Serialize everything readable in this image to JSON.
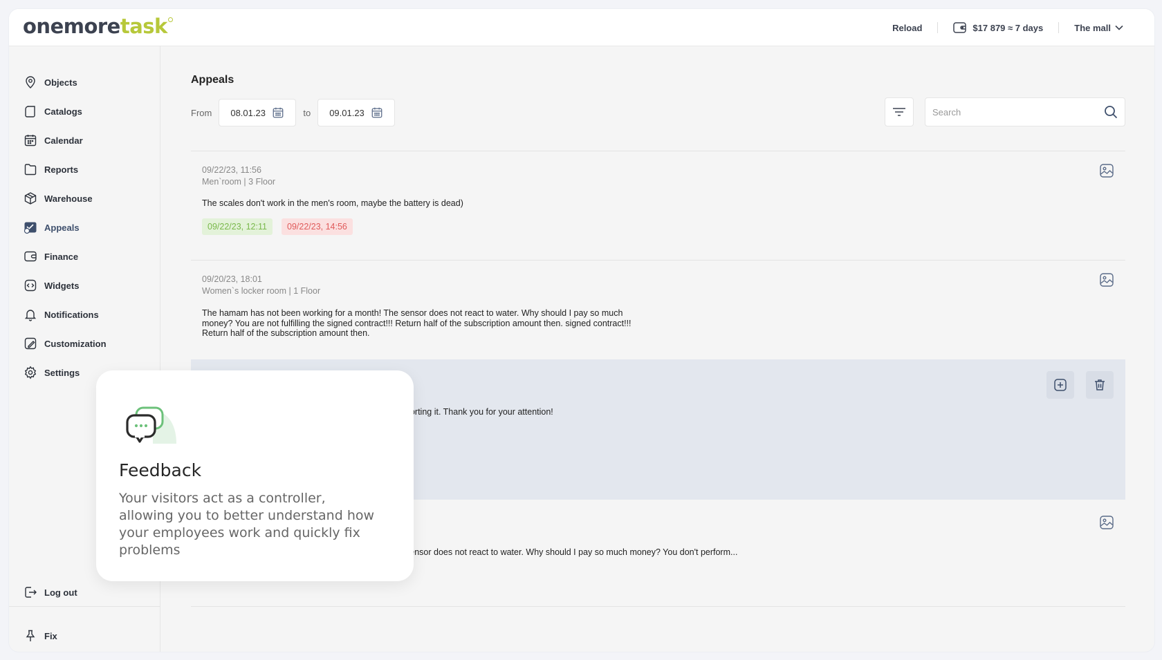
{
  "app": {
    "logo_part1": "onemore",
    "logo_part2": "task"
  },
  "header": {
    "reload_label": "Reload",
    "balance": "$17 879 ≈ 7 days",
    "location": "The mall"
  },
  "sidebar": {
    "items": [
      {
        "label": "Objects",
        "icon": "location-pin-icon"
      },
      {
        "label": "Catalogs",
        "icon": "catalog-icon"
      },
      {
        "label": "Calendar",
        "icon": "calendar-icon"
      },
      {
        "label": "Reports",
        "icon": "folder-icon"
      },
      {
        "label": "Warehouse",
        "icon": "box-icon"
      },
      {
        "label": "Appeals",
        "icon": "appeals-icon",
        "active": true
      },
      {
        "label": "Finance",
        "icon": "wallet-icon"
      },
      {
        "label": "Widgets",
        "icon": "widgets-icon"
      },
      {
        "label": "Notifications",
        "icon": "bell-icon"
      },
      {
        "label": "Customization",
        "icon": "brush-icon"
      },
      {
        "label": "Settings",
        "icon": "gear-icon"
      }
    ],
    "logout_label": "Log out",
    "fix_label": "Fix"
  },
  "main": {
    "title": "Appeals",
    "filter": {
      "from_label": "From",
      "from_date": "08.01.23",
      "to_label": "to",
      "to_date": "09.01.23"
    },
    "search_placeholder": "Search"
  },
  "appeals": [
    {
      "date": "09/22/23, 11:56",
      "location": "Men`room | 3 Floor",
      "text": "The scales don't work in the men's room, maybe the battery is dead)",
      "badges": [
        {
          "text": "09/22/23, 12:11",
          "status": "green"
        },
        {
          "text": "09/22/23, 14:56",
          "status": "red"
        }
      ]
    },
    {
      "date": "09/20/23, 18:01",
      "location": "Women`s locker room | 1 Floor",
      "text_lines": [
        "The hamam has not been working for a month! The sensor does not react to water. Why should I pay so much",
        "money? You are not fulfilling the signed contract!!! Return half of the subscription amount then. signed contract!!!",
        "Return half of the subscription amount then."
      ]
    },
    {
      "text_partial": "porting it. Thank you for your attention!"
    },
    {
      "text_partial": "sensor does not react to water. Why should I pay so much money? You don't perform..."
    }
  ],
  "feedback_card": {
    "title": "Feedback",
    "text": "Your visitors act as a controller, allowing you to better understand how your employees work and quickly fix problems"
  },
  "colors": {
    "accent": "#b7c83a",
    "nav_active": "#3e4f6c",
    "badge_green": "#79b84a",
    "badge_red": "#e05a5a"
  }
}
